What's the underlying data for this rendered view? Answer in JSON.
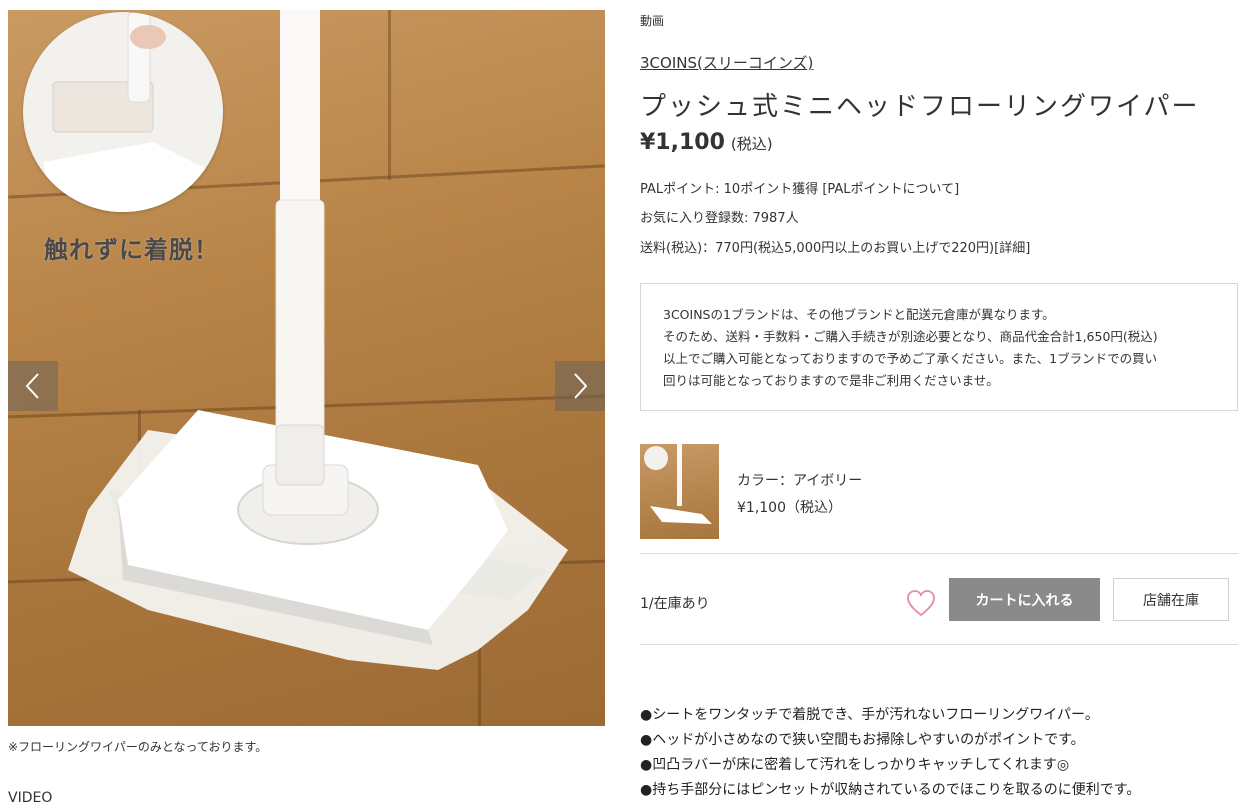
{
  "gallery": {
    "overlay_caption": "触れずに着脱！",
    "note": "※フローリングワイパーのみとなっております。",
    "video_label": "VIDEO",
    "prev_icon": "chevron-left-icon",
    "next_icon": "chevron-right-icon"
  },
  "product": {
    "breadcrumb": "動画",
    "brand": "3COINS(スリーコインズ)",
    "title": "プッシュ式ミニヘッドフローリングワイパー",
    "price": "¥1,100",
    "price_tax": "(税込)",
    "points": "PALポイント: 10ポイント獲得 [PALポイントについて]",
    "favorites": "お気に入り登録数: 7987人",
    "shipping": "送料(税込)：770円(税込5,000円以上のお買い上げで220円)[詳細]"
  },
  "notice": {
    "lines": [
      "3COINSの1ブランドは、その他ブランドと配送元倉庫が異なります。",
      "そのため、送料・手数料・ご購入手続きが別途必要となり、商品代金合計1,650円(税込)",
      "以上でご購入可能となっておりますので予めご了承ください。また、1ブランドでの買い",
      "回りは可能となっておりますので是非ご利用くださいませ。"
    ]
  },
  "variant": {
    "color": "カラー：アイボリー",
    "price": "¥1,100（税込）"
  },
  "purchase": {
    "stock": "1/在庫あり",
    "cart_label": "カートに入れる",
    "store_label": "店舗在庫",
    "favorite_icon": "heart-icon",
    "heart_color": "#e88aa8",
    "cart_color": "#8a8a8a"
  },
  "features": [
    "●シートをワンタッチで着脱でき、手が汚れないフローリングワイパー。",
    "●ヘッドが小さめなので狭い空間もお掃除しやすいのがポイントです。",
    "●凹凸ラバーが床に密着して汚れをしっかりキャッチしてくれます◎",
    "●持ち手部分にはピンセットが収納されているのでほこりを取るのに便利です。"
  ]
}
